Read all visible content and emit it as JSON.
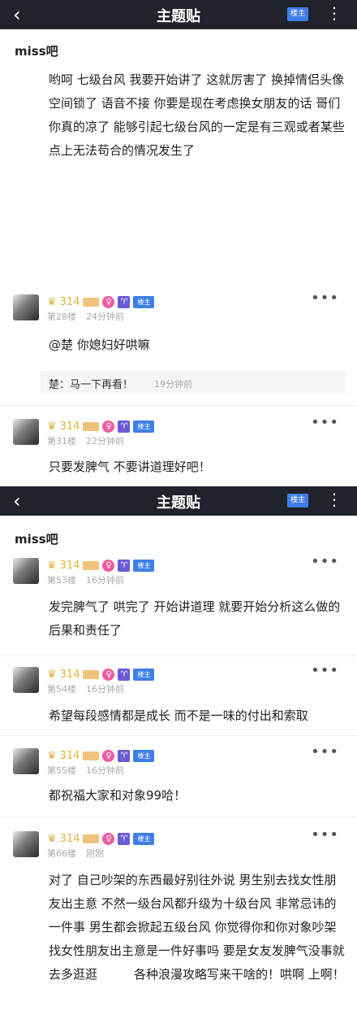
{
  "screen1": {
    "header": {
      "back_icon": "‹",
      "title": "主题贴",
      "caret": "⌃",
      "lz_label": "楼主",
      "more_icon": "⋮"
    },
    "bar_name": "miss吧",
    "main_text": "哟呵 七级台风 我要开始讲了 这就厉害了 换掉情侣头像 空间锁了 语音不接 你要是现在考虑换女朋友的话 哥们你真的凉了 能够引起七级台风的一定是有三观或者某些点上无法苟合的情况发生了",
    "posts": [
      {
        "level": "314",
        "floor": "第28楼",
        "time": "24分钟前",
        "text": "@楚 你媳妇好哄嘛",
        "reply": {
          "text": "楚：马一下再看！",
          "time": "19分钟前"
        }
      },
      {
        "level": "314",
        "floor": "第31楼",
        "time": "22分钟前",
        "text": "只要发脾气 不要讲道理好吧！"
      }
    ]
  },
  "screen2": {
    "header": {
      "back_icon": "‹",
      "title": "主题贴",
      "caret": "⌃",
      "lz_label": "楼主",
      "more_icon": "⋮"
    },
    "bar_name": "miss吧",
    "posts": [
      {
        "level": "314",
        "floor": "第53楼",
        "time": "16分钟前",
        "text": "发完脾气了 哄完了 开始讲道理 就要开始分析这么做的后果和责任了"
      },
      {
        "level": "314",
        "floor": "第54楼",
        "time": "16分钟前",
        "text": "希望每段感情都是成长 而不是一味的付出和索取"
      },
      {
        "level": "314",
        "floor": "第55楼",
        "time": "16分钟前",
        "text": "都祝福大家和对象99哈！"
      },
      {
        "level": "314",
        "floor": "第66楼",
        "time": "刚刚",
        "text": "对了 自己吵架的东西最好别往外说 男生别去找女性朋友出主意 不然一级台风都升级为十级台风 非常忌讳的一件事 男生都会掀起五级台风 你觉得你和你对象吵架 找女性朋友出主意是一件好事吗 要是女友发脾气没事就去多逛逛　　　各种浪漫攻略写来干啥的！哄啊 上啊！"
      }
    ]
  },
  "badges": {
    "crown_icon": "♛",
    "female_icon": "♀",
    "aries_icon": "♈",
    "lz_label": "楼主",
    "more_icon": "•••"
  },
  "colors": {
    "header_bg": "#20232b",
    "lz_badge": "#3f7ee8",
    "female": "#f05ba0",
    "aries": "#6a5ad6",
    "level": "#e2b33c"
  }
}
